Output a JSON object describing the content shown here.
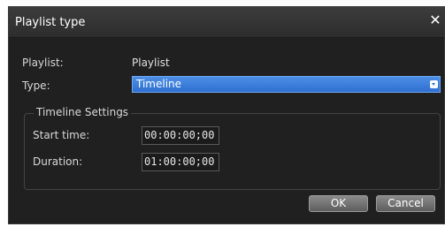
{
  "dialog": {
    "title": "Playlist type",
    "close_glyph": "✕"
  },
  "playlist": {
    "label": "Playlist:",
    "value": "Playlist"
  },
  "type": {
    "label": "Type:",
    "selected": "Timeline"
  },
  "timeline_settings": {
    "title": "Timeline Settings",
    "start_time_label": "Start time:",
    "start_time_value": "00:00:00;00",
    "duration_label": "Duration:",
    "duration_value": "01:00:00;00"
  },
  "buttons": {
    "ok": "OK",
    "cancel": "Cancel"
  },
  "icons": {
    "close": "close-icon",
    "dropdown": "chevron-down-icon"
  },
  "colors": {
    "dialog_bg": "#202020",
    "selection_accent": "#2f6fd0"
  }
}
